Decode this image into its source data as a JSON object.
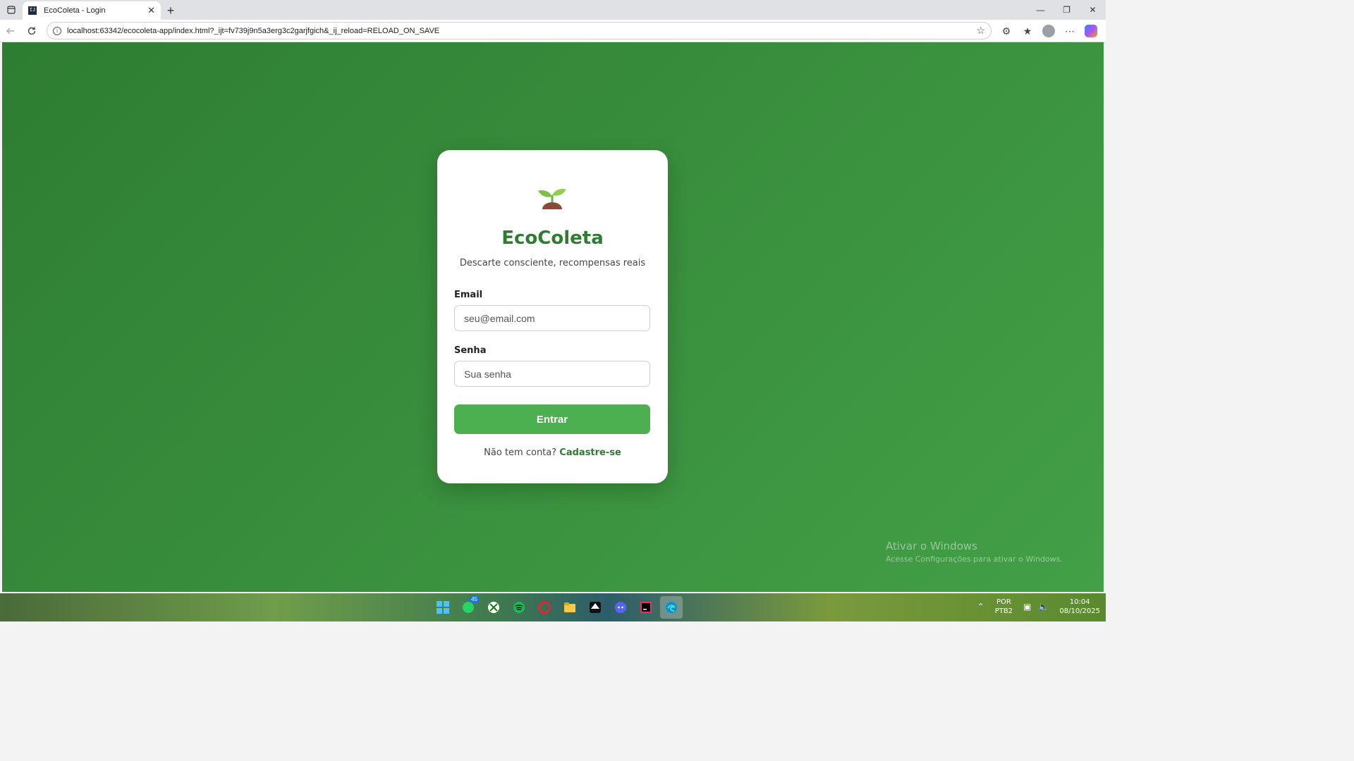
{
  "browser": {
    "tab_title": "EcoColeta - Login",
    "favicon_text": "IJ",
    "new_tab_symbol": "+",
    "close_symbol": "✕",
    "url": "localhost:63342/ecocoleta-app/index.html?_ijt=fv739j9n5a3erg3c2garjfgich&_ij_reload=RELOAD_ON_SAVE"
  },
  "login": {
    "brand": "EcoColeta",
    "tagline": "Descarte consciente, recompensas reais",
    "email_label": "Email",
    "email_placeholder": "seu@email.com",
    "password_label": "Senha",
    "password_placeholder": "Sua senha",
    "submit_label": "Entrar",
    "signup_prompt": "Não tem conta?",
    "signup_link": "Cadastre-se"
  },
  "watermark": {
    "line1": "Ativar o Windows",
    "line2": "Acesse Configurações para ativar o Windows."
  },
  "taskbar": {
    "badge_count": "45",
    "lang_line1": "POR",
    "lang_line2": "PTB2",
    "time": "10:04",
    "date": "08/10/2025",
    "icons": [
      "windows-start-icon",
      "whatsapp-icon",
      "xbox-icon",
      "spotify-icon",
      "opera-icon",
      "file-explorer-icon",
      "inkscape-icon",
      "discord-icon",
      "intellij-icon",
      "edge-icon"
    ]
  },
  "colors": {
    "brand_green": "#2e7d32",
    "button_green": "#4caf50",
    "background_start": "#2e7d32",
    "background_end": "#43a047"
  }
}
